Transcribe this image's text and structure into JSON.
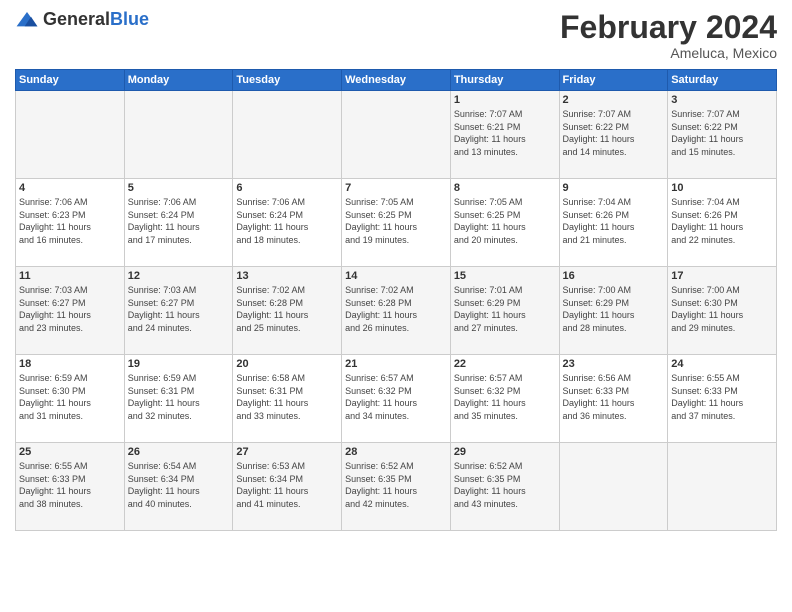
{
  "header": {
    "logo_general": "General",
    "logo_blue": "Blue",
    "title": "February 2024",
    "subtitle": "Ameluca, Mexico"
  },
  "days_of_week": [
    "Sunday",
    "Monday",
    "Tuesday",
    "Wednesday",
    "Thursday",
    "Friday",
    "Saturday"
  ],
  "weeks": [
    [
      {
        "day": "",
        "info": ""
      },
      {
        "day": "",
        "info": ""
      },
      {
        "day": "",
        "info": ""
      },
      {
        "day": "",
        "info": ""
      },
      {
        "day": "1",
        "info": "Sunrise: 7:07 AM\nSunset: 6:21 PM\nDaylight: 11 hours\nand 13 minutes."
      },
      {
        "day": "2",
        "info": "Sunrise: 7:07 AM\nSunset: 6:22 PM\nDaylight: 11 hours\nand 14 minutes."
      },
      {
        "day": "3",
        "info": "Sunrise: 7:07 AM\nSunset: 6:22 PM\nDaylight: 11 hours\nand 15 minutes."
      }
    ],
    [
      {
        "day": "4",
        "info": "Sunrise: 7:06 AM\nSunset: 6:23 PM\nDaylight: 11 hours\nand 16 minutes."
      },
      {
        "day": "5",
        "info": "Sunrise: 7:06 AM\nSunset: 6:24 PM\nDaylight: 11 hours\nand 17 minutes."
      },
      {
        "day": "6",
        "info": "Sunrise: 7:06 AM\nSunset: 6:24 PM\nDaylight: 11 hours\nand 18 minutes."
      },
      {
        "day": "7",
        "info": "Sunrise: 7:05 AM\nSunset: 6:25 PM\nDaylight: 11 hours\nand 19 minutes."
      },
      {
        "day": "8",
        "info": "Sunrise: 7:05 AM\nSunset: 6:25 PM\nDaylight: 11 hours\nand 20 minutes."
      },
      {
        "day": "9",
        "info": "Sunrise: 7:04 AM\nSunset: 6:26 PM\nDaylight: 11 hours\nand 21 minutes."
      },
      {
        "day": "10",
        "info": "Sunrise: 7:04 AM\nSunset: 6:26 PM\nDaylight: 11 hours\nand 22 minutes."
      }
    ],
    [
      {
        "day": "11",
        "info": "Sunrise: 7:03 AM\nSunset: 6:27 PM\nDaylight: 11 hours\nand 23 minutes."
      },
      {
        "day": "12",
        "info": "Sunrise: 7:03 AM\nSunset: 6:27 PM\nDaylight: 11 hours\nand 24 minutes."
      },
      {
        "day": "13",
        "info": "Sunrise: 7:02 AM\nSunset: 6:28 PM\nDaylight: 11 hours\nand 25 minutes."
      },
      {
        "day": "14",
        "info": "Sunrise: 7:02 AM\nSunset: 6:28 PM\nDaylight: 11 hours\nand 26 minutes."
      },
      {
        "day": "15",
        "info": "Sunrise: 7:01 AM\nSunset: 6:29 PM\nDaylight: 11 hours\nand 27 minutes."
      },
      {
        "day": "16",
        "info": "Sunrise: 7:00 AM\nSunset: 6:29 PM\nDaylight: 11 hours\nand 28 minutes."
      },
      {
        "day": "17",
        "info": "Sunrise: 7:00 AM\nSunset: 6:30 PM\nDaylight: 11 hours\nand 29 minutes."
      }
    ],
    [
      {
        "day": "18",
        "info": "Sunrise: 6:59 AM\nSunset: 6:30 PM\nDaylight: 11 hours\nand 31 minutes."
      },
      {
        "day": "19",
        "info": "Sunrise: 6:59 AM\nSunset: 6:31 PM\nDaylight: 11 hours\nand 32 minutes."
      },
      {
        "day": "20",
        "info": "Sunrise: 6:58 AM\nSunset: 6:31 PM\nDaylight: 11 hours\nand 33 minutes."
      },
      {
        "day": "21",
        "info": "Sunrise: 6:57 AM\nSunset: 6:32 PM\nDaylight: 11 hours\nand 34 minutes."
      },
      {
        "day": "22",
        "info": "Sunrise: 6:57 AM\nSunset: 6:32 PM\nDaylight: 11 hours\nand 35 minutes."
      },
      {
        "day": "23",
        "info": "Sunrise: 6:56 AM\nSunset: 6:33 PM\nDaylight: 11 hours\nand 36 minutes."
      },
      {
        "day": "24",
        "info": "Sunrise: 6:55 AM\nSunset: 6:33 PM\nDaylight: 11 hours\nand 37 minutes."
      }
    ],
    [
      {
        "day": "25",
        "info": "Sunrise: 6:55 AM\nSunset: 6:33 PM\nDaylight: 11 hours\nand 38 minutes."
      },
      {
        "day": "26",
        "info": "Sunrise: 6:54 AM\nSunset: 6:34 PM\nDaylight: 11 hours\nand 40 minutes."
      },
      {
        "day": "27",
        "info": "Sunrise: 6:53 AM\nSunset: 6:34 PM\nDaylight: 11 hours\nand 41 minutes."
      },
      {
        "day": "28",
        "info": "Sunrise: 6:52 AM\nSunset: 6:35 PM\nDaylight: 11 hours\nand 42 minutes."
      },
      {
        "day": "29",
        "info": "Sunrise: 6:52 AM\nSunset: 6:35 PM\nDaylight: 11 hours\nand 43 minutes."
      },
      {
        "day": "",
        "info": ""
      },
      {
        "day": "",
        "info": ""
      }
    ]
  ]
}
